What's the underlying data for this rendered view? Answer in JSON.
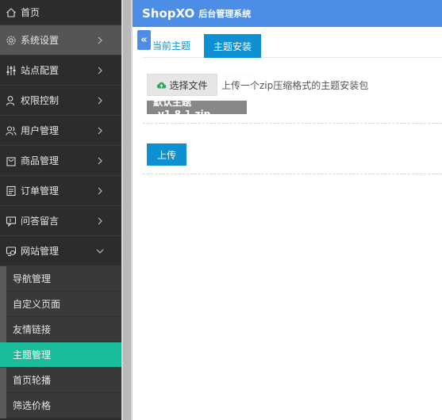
{
  "header": {
    "brand": "ShopXO",
    "subtitle": "后台管理系统"
  },
  "sidebar": {
    "items": [
      {
        "label": "首页",
        "icon": "home-icon"
      },
      {
        "label": "系统设置",
        "icon": "gear-icon"
      },
      {
        "label": "站点配置",
        "icon": "sliders-icon"
      },
      {
        "label": "权限控制",
        "icon": "user-icon"
      },
      {
        "label": "用户管理",
        "icon": "users-icon"
      },
      {
        "label": "商品管理",
        "icon": "bag-icon"
      },
      {
        "label": "订单管理",
        "icon": "document-icon"
      },
      {
        "label": "问答留言",
        "icon": "chat-icon"
      },
      {
        "label": "网站管理",
        "icon": "web-icon"
      }
    ],
    "sub_items": [
      {
        "label": "导航管理"
      },
      {
        "label": "自定义页面"
      },
      {
        "label": "友情链接"
      },
      {
        "label": "主题管理"
      },
      {
        "label": "首页轮播"
      },
      {
        "label": "筛选价格"
      }
    ]
  },
  "tabs": {
    "current": "当前主题",
    "install": "主题安装"
  },
  "form": {
    "choose_file": "选择文件",
    "hint": "上传一个zip压缩格式的主题安装包",
    "file_name": "默认主题_v1.8.1.zip",
    "upload": "上传"
  },
  "colors": {
    "header": "#4c8de6",
    "primary": "#0e90d2",
    "active_sub": "#1bbc9b",
    "sidebar_bg": "#2c2c2c"
  }
}
